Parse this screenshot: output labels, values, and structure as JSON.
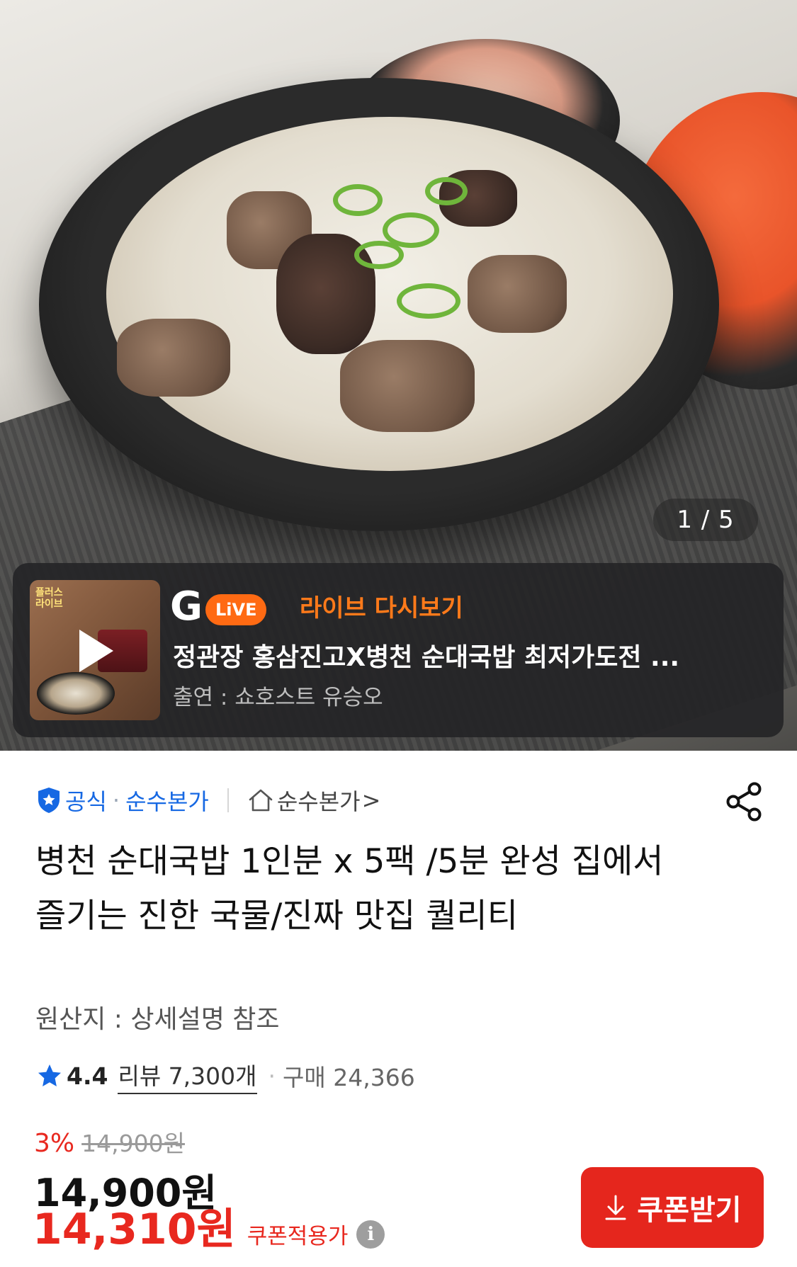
{
  "gallery": {
    "counter": "1 / 5"
  },
  "live": {
    "thumb_badge": "플러스\n라이브",
    "logo_letter": "G",
    "logo_live": "LiVE",
    "replay_label": "라이브 다시보기",
    "headline": "정관장 홍삼진고X병천 순대국밥 최저가도전 ...",
    "cast": "출연 : 쇼호스트 유승오"
  },
  "seller": {
    "official": "공식",
    "brand": "순수본가",
    "store": "순수본가",
    "store_chevron": ">"
  },
  "product": {
    "title": "병천 순대국밥 1인분 x 5팩 /5분 완성 집에서 즐기는 진한 국물/진짜 맛집 퀄리티",
    "origin": "원산지 : 상세설명 참조",
    "rating": "4.4",
    "review": "리뷰 7,300개",
    "buy": "구매 24,366"
  },
  "price": {
    "discount": "3%",
    "original": "14,900원",
    "sale": "14,900원",
    "coupon_price": "14,310원",
    "coupon_label": "쿠폰적용가",
    "info": "i",
    "coupon_button": "쿠폰받기"
  },
  "colors": {
    "brand_blue": "#1668e3",
    "accent_red": "#e5261d",
    "live_orange": "#ff6a13"
  },
  "icons": [
    "shield-icon",
    "home-icon",
    "share-icon",
    "star-icon",
    "play-icon",
    "info-icon",
    "download-icon"
  ]
}
